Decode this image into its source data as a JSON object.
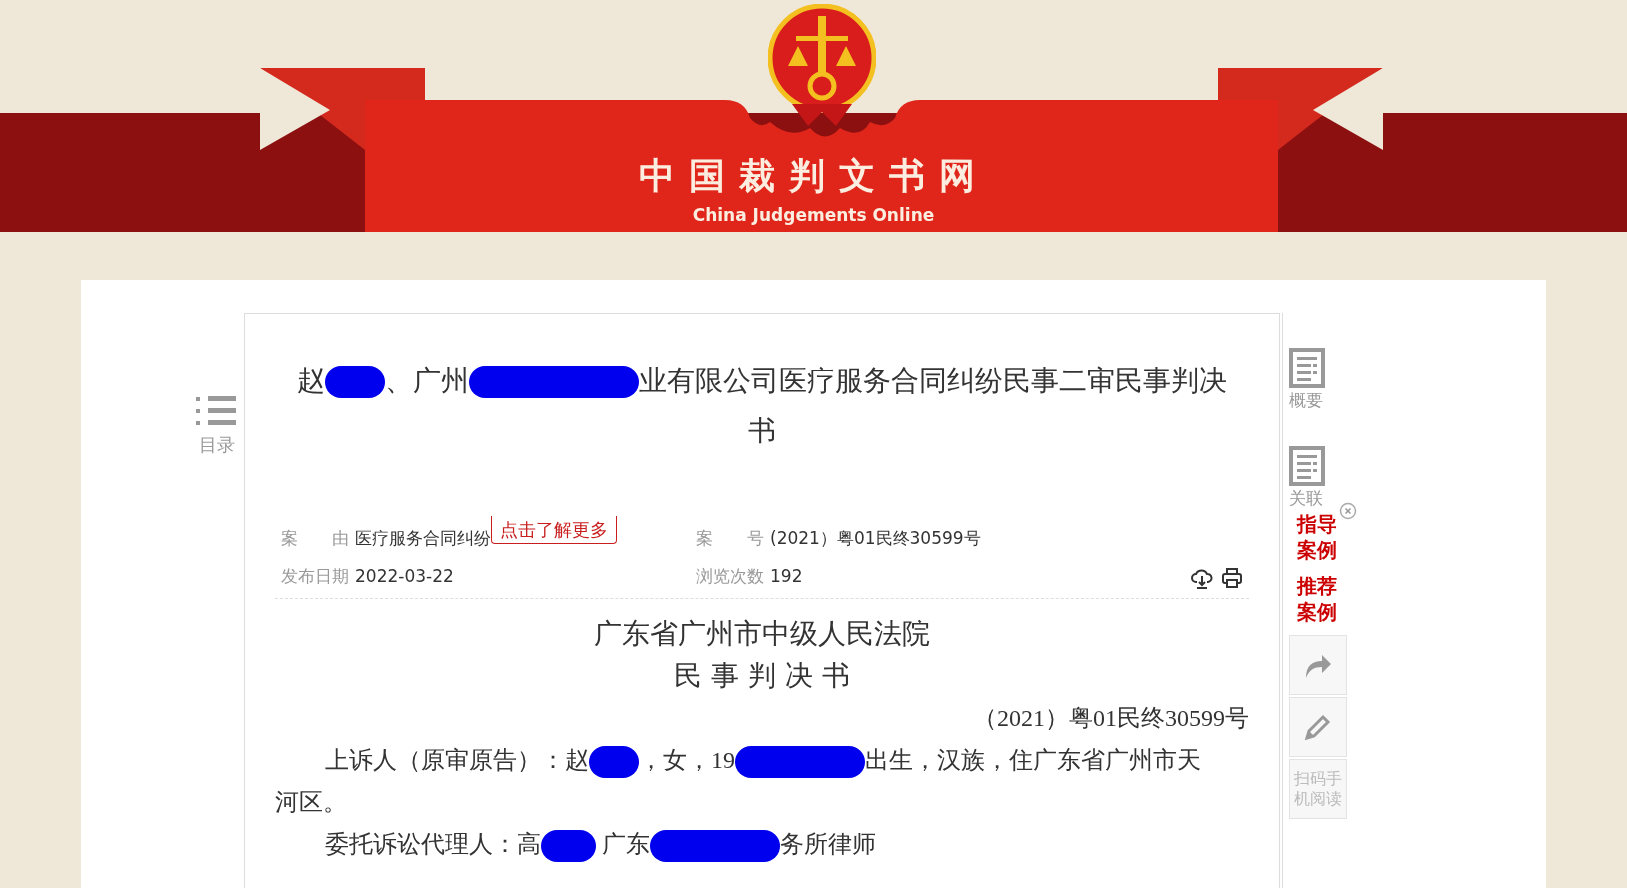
{
  "header": {
    "site_name": "中国裁判文书网",
    "site_name_en": "China Judgements Online"
  },
  "toc": {
    "label": "目录"
  },
  "document": {
    "title": [
      {
        "kind": "text",
        "text": "赵"
      },
      {
        "kind": "redaction"
      },
      {
        "kind": "text",
        "text": "、广州"
      },
      {
        "kind": "redaction"
      },
      {
        "kind": "text",
        "text": "业有限公司医疗服务合同纠纷民事二审民事判决书"
      }
    ],
    "meta": [
      {
        "label": "案　　由",
        "value": "医疗服务合同纠纷",
        "link": "点击了解更多"
      },
      {
        "label": "案　　号",
        "value": "(2021）粤01民终30599号"
      },
      {
        "label": "发布日期",
        "value": "2022-03-22"
      },
      {
        "label": "浏览次数",
        "value": "192"
      }
    ],
    "court": "广东省广州市中级人民法院",
    "doc_type": "民 事 判 决 书",
    "case_number": "（2021）粤01民终30599号",
    "paragraphs": [
      [
        {
          "kind": "text",
          "text": "上诉人（原审原告）：赵"
        },
        {
          "kind": "redaction"
        },
        {
          "kind": "text",
          "text": "，女，19"
        },
        {
          "kind": "redaction"
        },
        {
          "kind": "text",
          "text": "出生，汉族，住广东省广州市天"
        },
        {
          "kind": "text",
          "text": "河区。"
        }
      ],
      [
        {
          "kind": "text",
          "text": "委托诉讼代理人：高"
        },
        {
          "kind": "redaction"
        },
        {
          "kind": "text",
          "text": " 广东"
        },
        {
          "kind": "redaction"
        },
        {
          "kind": "text",
          "text": "务所律师"
        }
      ]
    ]
  },
  "rail": [
    {
      "kind": "icon",
      "label": "概要"
    },
    {
      "kind": "icon",
      "label": "关联",
      "closable": true
    },
    {
      "kind": "link",
      "label": "指导案例"
    },
    {
      "kind": "link",
      "label": "推荐案例"
    },
    {
      "kind": "share"
    },
    {
      "kind": "edit"
    },
    {
      "kind": "qr",
      "label": "扫码手机阅读"
    }
  ]
}
